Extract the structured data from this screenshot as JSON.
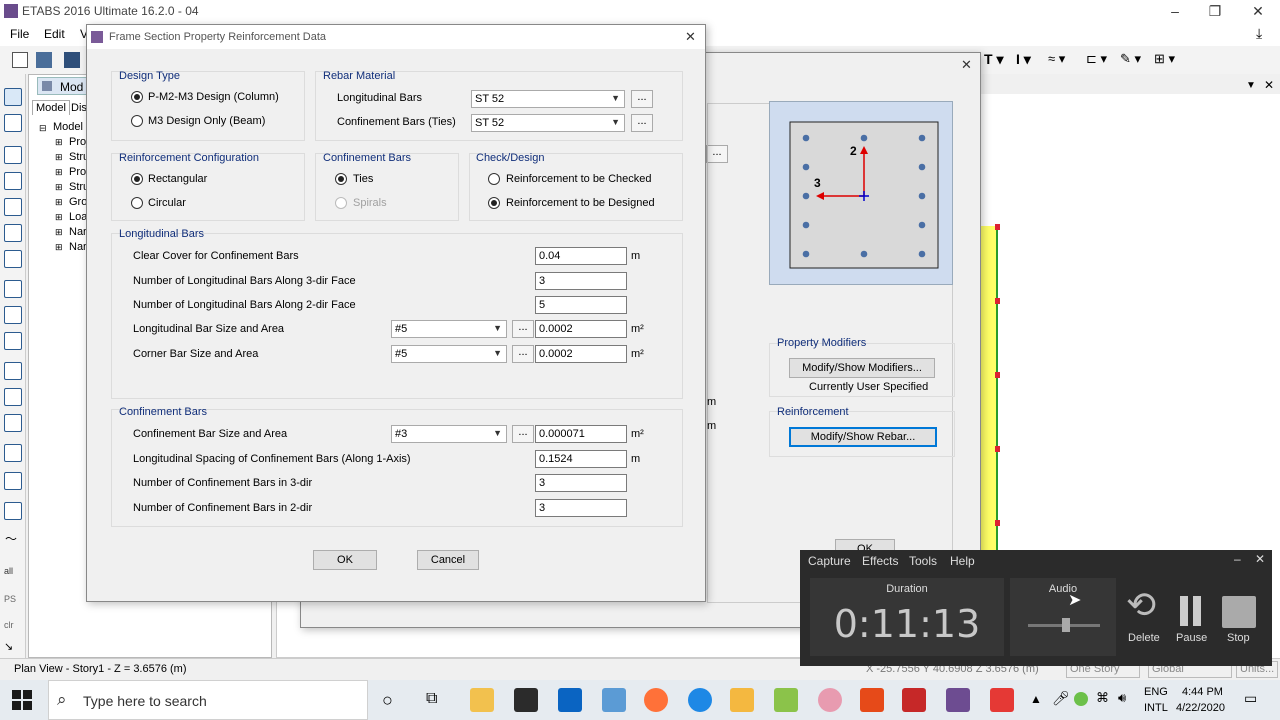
{
  "app": {
    "title": "ETABS 2016 Ultimate 16.2.0 - 04",
    "menu": [
      "File",
      "Edit",
      "V"
    ]
  },
  "model_panel": {
    "tabs": [
      "Model",
      "Dis"
    ],
    "root": "Model",
    "items": [
      "Proj",
      "Stru",
      "Prop",
      "Stru",
      "Grou",
      "Loa",
      "Nar",
      "Nar"
    ]
  },
  "doc_tab_label": "Mod",
  "dialog": {
    "title": "Frame Section Property Reinforcement Data",
    "design_type": {
      "title": "Design Type",
      "options": [
        {
          "label": "P-M2-M3 Design  (Column)",
          "selected": true
        },
        {
          "label": "M3 Design Only  (Beam)",
          "selected": false
        }
      ]
    },
    "rebar_material": {
      "title": "Rebar Material",
      "longitudinal_label": "Longitudinal Bars",
      "longitudinal_value": "ST 52",
      "confinement_label": "Confinement Bars (Ties)",
      "confinement_value": "ST 52"
    },
    "reinf_config": {
      "title": "Reinforcement Configuration",
      "options": [
        {
          "label": "Rectangular",
          "selected": true
        },
        {
          "label": "Circular",
          "selected": false
        }
      ]
    },
    "confinement_type": {
      "title": "Confinement Bars",
      "options": [
        {
          "label": "Ties",
          "selected": true
        },
        {
          "label": "Spirals",
          "selected": false
        }
      ]
    },
    "check_design": {
      "title": "Check/Design",
      "options": [
        {
          "label": "Reinforcement to be Checked",
          "selected": false
        },
        {
          "label": "Reinforcement to be Designed",
          "selected": true
        }
      ]
    },
    "longitudinal": {
      "title": "Longitudinal Bars",
      "clear_cover_label": "Clear Cover for Confinement Bars",
      "clear_cover_value": "0.04",
      "clear_cover_unit": "m",
      "n3_label": "Number of Longitudinal Bars Along 3-dir Face",
      "n3_value": "3",
      "n2_label": "Number of Longitudinal Bars Along 2-dir Face",
      "n2_value": "5",
      "bar_label": "Longitudinal Bar Size and Area",
      "bar_size": "#5",
      "bar_area": "0.0002",
      "bar_unit": "m²",
      "corner_label": "Corner Bar Size and Area",
      "corner_size": "#5",
      "corner_area": "0.0002",
      "corner_unit": "m²"
    },
    "confinement": {
      "title": "Confinement Bars",
      "bar_label": "Confinement Bar Size and Area",
      "bar_size": "#3",
      "bar_area": "0.000071",
      "bar_unit": "m²",
      "spacing_label": "Longitudinal Spacing of Confinement Bars  (Along 1-Axis)",
      "spacing_value": "0.1524",
      "spacing_unit": "m",
      "n3_label": "Number of Confinement Bars in 3-dir",
      "n3_value": "3",
      "n2_label": "Number of Confinement Bars in 2-dir",
      "n2_value": "3"
    },
    "ok_label": "OK",
    "cancel_label": "Cancel",
    "ellipsis": "..."
  },
  "bg_dialog": {
    "preview_axis2": "2",
    "preview_axis3": "3",
    "property_modifiers_title": "Property Modifiers",
    "modify_modifiers_label": "Modify/Show Modifiers...",
    "currently_user_specified": "Currently User Specified",
    "reinforcement_title": "Reinforcement",
    "modify_rebar_label": "Modify/Show Rebar...",
    "ok_label": "OK",
    "ellipsis": "...",
    "m1": "m",
    "m2": "m"
  },
  "statusbar": {
    "view": "Plan View - Story1 - Z = 3.6576 (m)",
    "coords": "X -25.7556  Y 40.6908  Z 3.6576 (m)",
    "story": "One Story",
    "system": "Global",
    "units": "Units..."
  },
  "recorder": {
    "menu": [
      "Capture",
      "Effects",
      "Tools",
      "Help"
    ],
    "duration_label": "Duration",
    "duration_value": "0:11:13",
    "audio_label": "Audio",
    "delete_label": "Delete",
    "pause_label": "Pause",
    "stop_label": "Stop"
  },
  "taskbar": {
    "search_placeholder": "Type here to search",
    "lang1": "ENG",
    "lang2": "INTL",
    "time": "4:44 PM",
    "date": "4/22/2020"
  }
}
